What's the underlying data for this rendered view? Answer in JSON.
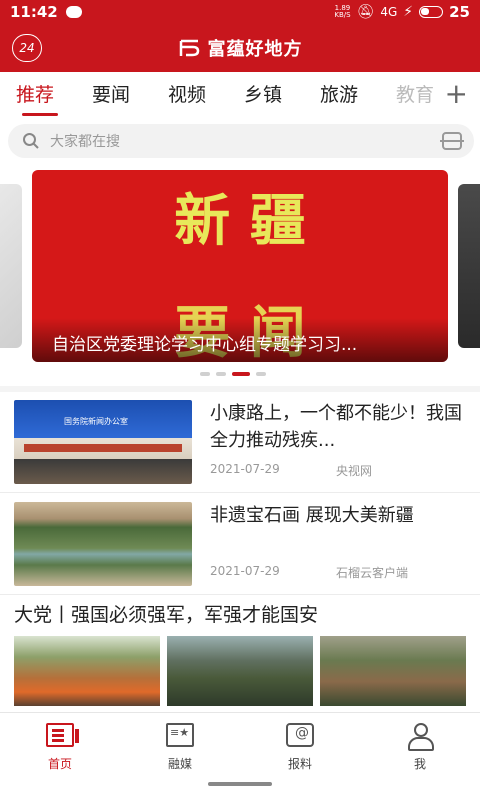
{
  "status_bar": {
    "time": "11:42",
    "net_speed_value": "1.89",
    "net_speed_unit": "KB/S",
    "signal": "4G",
    "battery": "25"
  },
  "header": {
    "badge": "24",
    "app_title": "富蕴好地方"
  },
  "tabs": [
    {
      "label": "推荐",
      "active": true
    },
    {
      "label": "要闻",
      "active": false
    },
    {
      "label": "视频",
      "active": false
    },
    {
      "label": "乡镇",
      "active": false
    },
    {
      "label": "旅游",
      "active": false
    },
    {
      "label": "教育",
      "active": false
    }
  ],
  "tab_add_label": "+",
  "search": {
    "placeholder": "大家都在搜"
  },
  "carousel": {
    "banner_text_line1": "新 疆",
    "banner_text_line2": "要 闻",
    "caption": "自治区党委理论学习中心组专题学习习...",
    "active_index": 2,
    "count": 4
  },
  "news": [
    {
      "title": "小康路上，一个都不能少！我国全力推动残疾...",
      "date": "2021-07-29",
      "source": "央视网",
      "thumb_sign": "国务院新闻办公室"
    },
    {
      "title": "非遗宝石画 展现大美新疆",
      "date": "2021-07-29",
      "source": "石榴云客户端"
    }
  ],
  "section": {
    "title": "大党丨强国必须强军，军强才能国安"
  },
  "bottom_nav": [
    {
      "label": "首页",
      "icon": "home-icon",
      "active": true
    },
    {
      "label": "融媒",
      "icon": "media-icon",
      "active": false
    },
    {
      "label": "报料",
      "icon": "report-icon",
      "active": false
    },
    {
      "label": "我",
      "icon": "profile-icon",
      "active": false
    }
  ],
  "colors": {
    "brand_red": "#c8161d",
    "banner_text_yellow": "#e8e85a"
  }
}
